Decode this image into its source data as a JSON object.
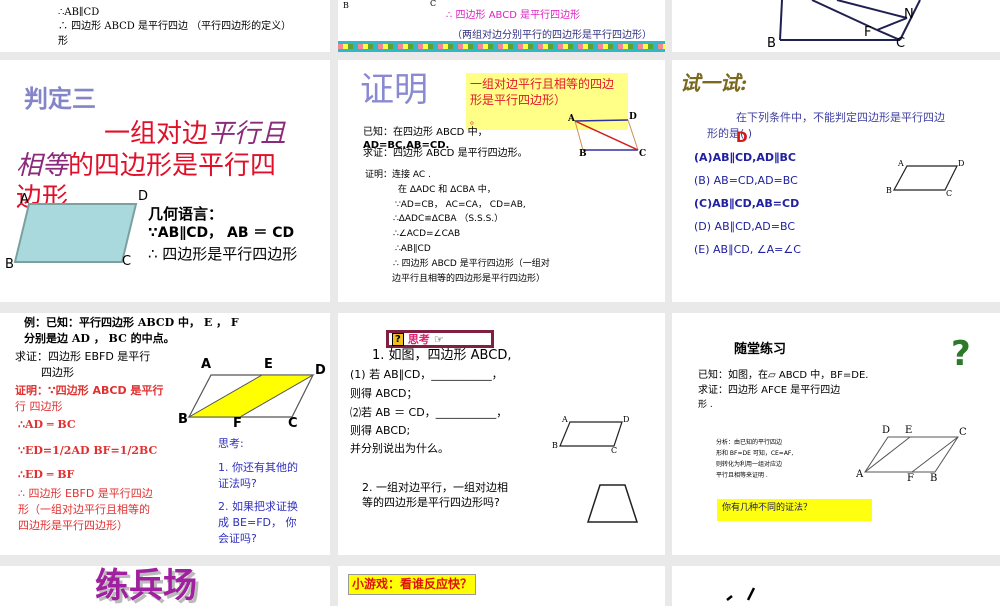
{
  "slides": [
    {
      "lines": [
        "∴AB∥CD",
        "∴ 四边形 ABCD 是平行四边  （平行四边形的定义）",
        "形"
      ]
    },
    {
      "labels": [
        "B",
        "C"
      ],
      "conclusion": "∴ 四边形 ABCD 是平行四边形",
      "reason": "（两组对边分别平行的四边形是平行四边形）"
    },
    {
      "labels": [
        "N",
        "F",
        "B",
        "C"
      ]
    },
    {
      "title": "判定三",
      "theorem_1": "一组对边",
      "theorem_1i": "平行且",
      "theorem_2i": "相等",
      "theorem_2": "的四边形是平行四",
      "theorem_3": "边形",
      "labels": [
        "A",
        "D",
        "B",
        "C"
      ],
      "geo_title": "几何语言：",
      "geo_1": "∵AB∥CD，  AB ＝ CD",
      "geo_2": "∴ 四边形是平行四边形"
    },
    {
      "title": "证明",
      "note": "一组对边平行且相等的四边形是平行四边形）",
      "note_dot": "。",
      "labels": [
        "A",
        "D",
        "B",
        "C"
      ],
      "lines": [
        "已知：在四边形 ABCD 中，",
        "AD=BC,AB=CD.",
        "求证：四边形 ABCD 是平行四边形。",
        "证明：连接 AC .",
        "在 ΔADC 和 ΔCBA 中，",
        "∵AD=CB， AC=CA， CD=AB,",
        "∴ΔADC≌ΔCBA （S.S.S.）",
        "∴∠ACD=∠CAB",
        "∴AB∥CD",
        "∴ 四边形 ABCD 是平行四边形（一组对",
        "边平行且相等的四边形是平行四边形）"
      ]
    },
    {
      "title": "试一试:",
      "question_1": "在下列条件中，不能判定四边形是平行四边",
      "question_2": "形的是(      )",
      "answer": "D",
      "options": [
        "(A)AB∥CD,AD∥BC",
        "(B) AB=CD,AD=BC",
        "(C)AB∥CD,AB=CD",
        "(D) AB∥CD,AD=BC",
        "(E) AB∥CD, ∠A=∠C"
      ],
      "labels": [
        "A",
        "D",
        "B",
        "C"
      ]
    },
    {
      "given_1": "例：已知：平行四边形 ABCD 中， E ， F",
      "given_2": "分别是边 AD ， BC 的中点。",
      "prove_1": "求证：四边形 EBFD 是平行",
      "prove_2": "四边形",
      "proof": [
        "证明：∵四边形 ABCD 是平行",
        "行        四边形",
        "∴AD ═ BC",
        "∵ED=1/2AD    BF=1/2BC",
        "∴ED ═ BF",
        "∴ 四边形 EBFD 是平行四边",
        "形（一组对边平行且相等的",
        "四边形是平行四边形）"
      ],
      "think": [
        "思考:",
        "1. 你还有其他的",
        "证法吗?",
        "2. 如果把求证换",
        "成 BE=FD， 你",
        "会证吗?"
      ],
      "labels": [
        "A",
        "E",
        "D",
        "B",
        "F",
        "C"
      ]
    },
    {
      "badge": "思考",
      "lines": [
        "1. 如图，四边形 ABCD,",
        "(1) 若 AB∥CD，___________，",
        "则得      ABCD；",
        "⑵若 AB ＝ CD，___________，",
        "则得      ABCD;",
        "并分别说出为什么。"
      ],
      "q2_1": "2. 一组对边平行，一组对边相",
      "q2_2": "等的四边形是平行四边形吗?",
      "labels": [
        "A",
        "D",
        "B",
        "C"
      ]
    },
    {
      "title": "随堂练习",
      "given": "已知：如图，在▱ ABCD 中，BF=DE.",
      "prove_1": "求证：四边形 AFCE 是平行四边",
      "prove_2": "形 .",
      "analysis": [
        "分析：由已知的平行四边",
        "形和 BF=DE 可知，CE=AF,",
        "则转化为利用一组对应边",
        "平行且相等来证明 ."
      ],
      "callout": "你有几种不同的证法？",
      "labels": [
        "D",
        "E",
        "C",
        "A",
        "F",
        "B"
      ]
    },
    {
      "title": "练兵场"
    },
    {
      "game": "小游戏：看谁反应快？"
    },
    {}
  ]
}
